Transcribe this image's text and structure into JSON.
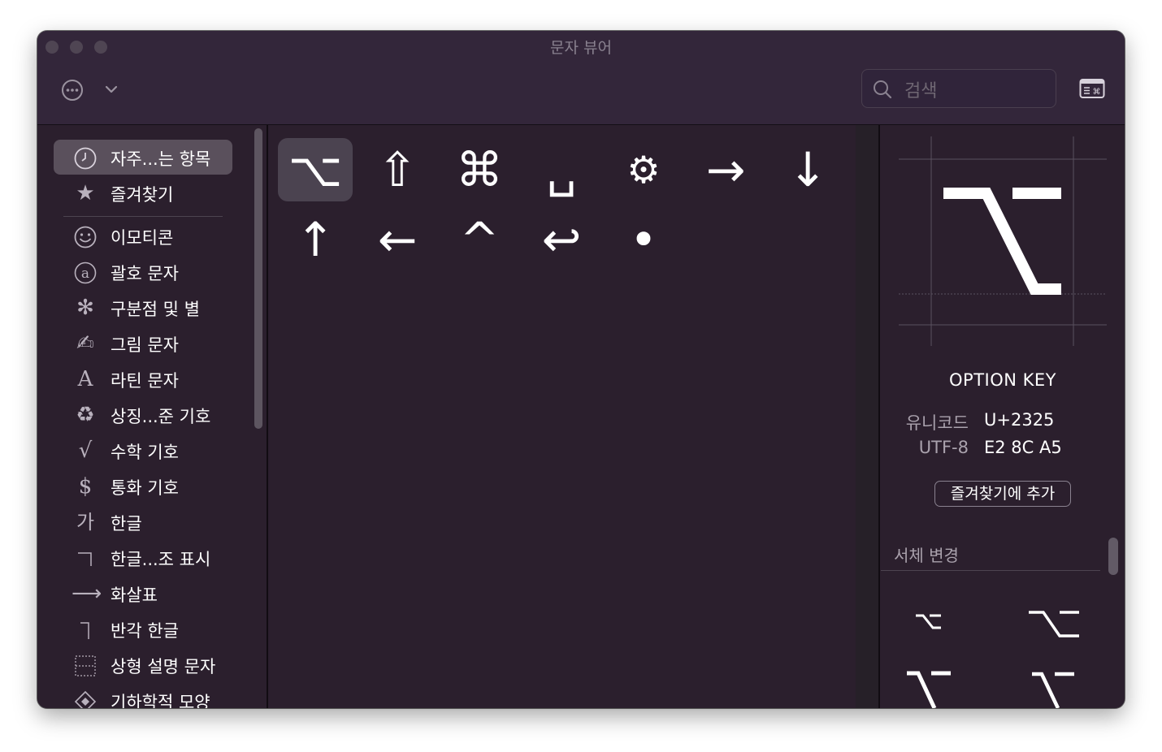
{
  "window": {
    "title": "문자 뷰어"
  },
  "toolbar": {
    "more_icon": "ellipsis-circle-icon",
    "chevron_icon": "chevron-down-icon",
    "search_placeholder": "검색",
    "keyboard_icon": "keyboard-viewer-icon"
  },
  "sidebar": {
    "items": [
      {
        "label": "자주...는 항목",
        "icon": "clock-icon",
        "active": true
      },
      {
        "label": "즐겨찾기",
        "icon": "star-icon"
      },
      {
        "label": "이모티콘",
        "icon": "smiley-icon"
      },
      {
        "label": "괄호 문자",
        "icon": "circled-a-icon"
      },
      {
        "label": "구분점 및 별",
        "icon": "asterisk-icon"
      },
      {
        "label": "그림 문자",
        "icon": "writing-hand-icon"
      },
      {
        "label": "라틴 문자",
        "icon": "latin-a-icon"
      },
      {
        "label": "상징...준 기호",
        "icon": "recycle-icon"
      },
      {
        "label": "수학 기호",
        "icon": "square-root-icon"
      },
      {
        "label": "통화 기호",
        "icon": "dollar-icon"
      },
      {
        "label": "한글",
        "icon": "hangul-ga-icon"
      },
      {
        "label": "한글...조 표시",
        "icon": "hangul-giyeok-icon"
      },
      {
        "label": "화살표",
        "icon": "arrow-right-icon"
      },
      {
        "label": "반각 한글",
        "icon": "halfwidth-hangul-icon"
      },
      {
        "label": "상형 설명 문자",
        "icon": "ideographic-description-icon"
      },
      {
        "label": "기하학적 모양",
        "icon": "diamond-icon"
      }
    ]
  },
  "characters": [
    {
      "glyph": "⌥",
      "name": "option-key",
      "selected": true
    },
    {
      "glyph": "⇧",
      "name": "shift-key"
    },
    {
      "glyph": "⌘",
      "name": "command-key"
    },
    {
      "glyph": "␣",
      "name": "space-key"
    },
    {
      "glyph": "⚙",
      "name": "gear"
    },
    {
      "glyph": "→",
      "name": "right-arrow"
    },
    {
      "glyph": "↓",
      "name": "down-arrow"
    },
    {
      "glyph": "↑",
      "name": "up-arrow"
    },
    {
      "glyph": "←",
      "name": "left-arrow"
    },
    {
      "glyph": "^",
      "name": "control-key"
    },
    {
      "glyph": "↩",
      "name": "return-key"
    },
    {
      "glyph": "•",
      "name": "bullet"
    }
  ],
  "detail": {
    "preview_glyph": "⌥",
    "name": "OPTION KEY",
    "unicode_label": "유니코드",
    "unicode_value": "U+2325",
    "utf8_label": "UTF-8",
    "utf8_value": "E2 8C A5",
    "favorite_button": "즐겨찾기에 추가",
    "font_variation_title": "서체 변경",
    "variations": [
      "⌥",
      "⌥",
      "⌥",
      "⌥"
    ]
  }
}
